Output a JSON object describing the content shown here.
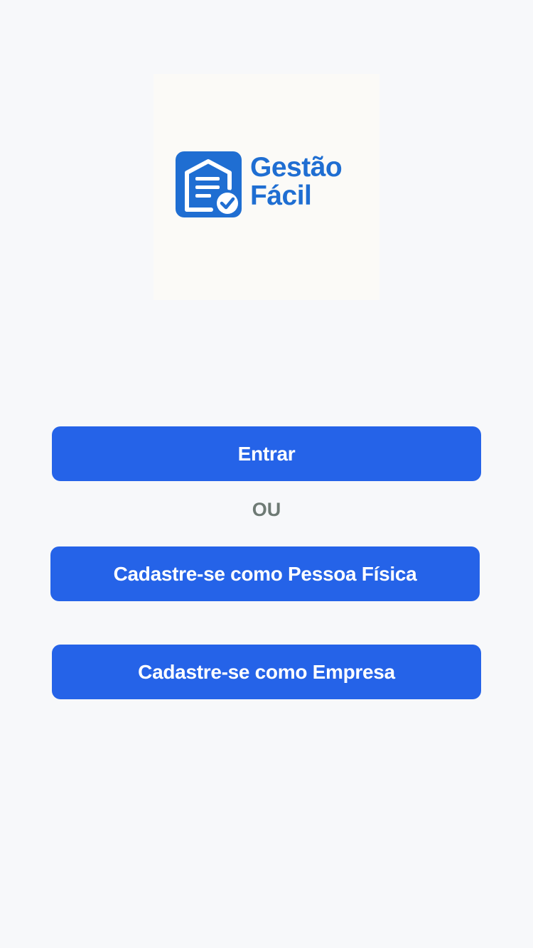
{
  "logo": {
    "line1": "Gestão",
    "line2": "Fácil",
    "brand_color": "#1f6ed2",
    "icon": "document-check-icon"
  },
  "actions": {
    "login_label": "Entrar",
    "separator": "OU",
    "register_person_label": "Cadastre-se como Pessoa Física",
    "register_company_label": "Cadastre-se como Empresa"
  },
  "colors": {
    "button": "#2563e8",
    "background": "#f7f8fa",
    "separator_text": "#6e7a74"
  }
}
